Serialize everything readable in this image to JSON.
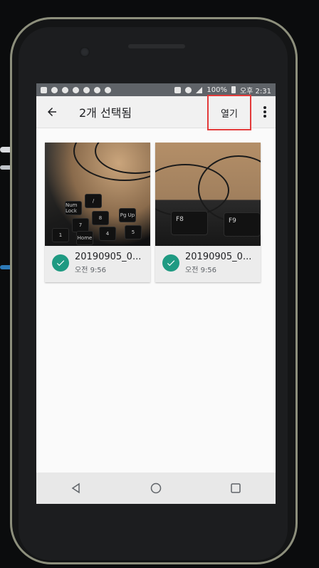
{
  "statusbar": {
    "battery_percent": "100%",
    "time": "오후 2:31"
  },
  "appbar": {
    "title": "2개 선택됨",
    "open_label": "열기",
    "back_icon": "arrow-back-icon",
    "more_icon": "more-vert-icon"
  },
  "items": [
    {
      "name": "20190905_0...",
      "time": "오전 9:56",
      "selected": true
    },
    {
      "name": "20190905_0...",
      "time": "오전 9:56",
      "selected": true
    }
  ],
  "thumb_keys": {
    "left": [
      "Num Lock",
      "/",
      "7",
      "8",
      "Pg Up",
      "Home",
      "4",
      "5",
      "1"
    ],
    "right": [
      "F8",
      "F9"
    ]
  },
  "colors": {
    "accent": "#1f9a82",
    "highlight_box": "#e23a3a",
    "statusbar": "#5f6368"
  }
}
